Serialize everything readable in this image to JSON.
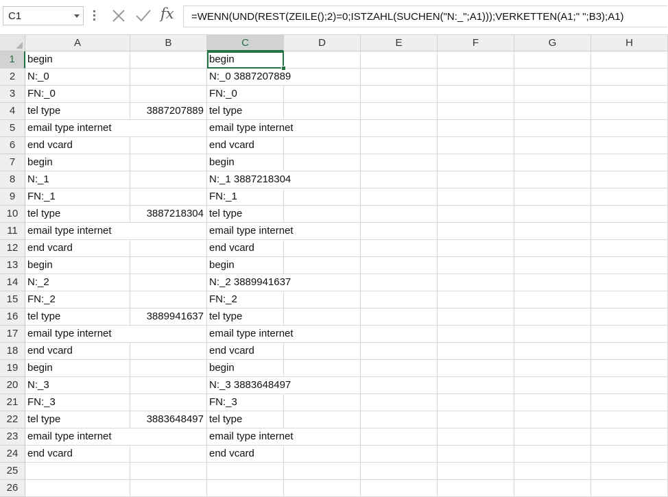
{
  "name_box": {
    "value": "C1"
  },
  "formula_bar": {
    "cancel_icon": "close-x-icon",
    "enter_icon": "checkmark-icon",
    "fx_label": "fx",
    "formula": "=WENN(UND(REST(ZEILE();2)=0;ISTZAHL(SUCHEN(\"N:_\";A1)));VERKETTEN(A1;\" \";B3);A1)"
  },
  "columns": [
    "A",
    "B",
    "C",
    "D",
    "E",
    "F",
    "G",
    "H"
  ],
  "selected_cell": {
    "column": "C",
    "row": 1
  },
  "rows": [
    {
      "n": "1",
      "a": "begin",
      "b": "",
      "c": "begin"
    },
    {
      "n": "2",
      "a": "N:_0",
      "b": "",
      "c": "N:_0 3887207889"
    },
    {
      "n": "3",
      "a": "FN:_0",
      "b": "",
      "c": "FN:_0"
    },
    {
      "n": "4",
      "a": "tel type",
      "b": "3887207889",
      "c": "tel type"
    },
    {
      "n": "5",
      "a": "email type internet",
      "b": "",
      "c": "email type internet"
    },
    {
      "n": "6",
      "a": "end vcard",
      "b": "",
      "c": "end vcard"
    },
    {
      "n": "7",
      "a": "begin",
      "b": "",
      "c": "begin"
    },
    {
      "n": "8",
      "a": "N:_1",
      "b": "",
      "c": "N:_1 3887218304"
    },
    {
      "n": "9",
      "a": "FN:_1",
      "b": "",
      "c": "FN:_1"
    },
    {
      "n": "10",
      "a": "tel type",
      "b": "3887218304",
      "c": "tel type"
    },
    {
      "n": "11",
      "a": "email type internet",
      "b": "",
      "c": "email type internet"
    },
    {
      "n": "12",
      "a": "end vcard",
      "b": "",
      "c": "end vcard"
    },
    {
      "n": "13",
      "a": "begin",
      "b": "",
      "c": "begin"
    },
    {
      "n": "14",
      "a": "N:_2",
      "b": "",
      "c": "N:_2 3889941637"
    },
    {
      "n": "15",
      "a": "FN:_2",
      "b": "",
      "c": "FN:_2"
    },
    {
      "n": "16",
      "a": "tel type",
      "b": "3889941637",
      "c": "tel type"
    },
    {
      "n": "17",
      "a": "email type internet",
      "b": "",
      "c": "email type internet"
    },
    {
      "n": "18",
      "a": "end vcard",
      "b": "",
      "c": "end vcard"
    },
    {
      "n": "19",
      "a": "begin",
      "b": "",
      "c": "begin"
    },
    {
      "n": "20",
      "a": "N:_3",
      "b": "",
      "c": "N:_3 3883648497"
    },
    {
      "n": "21",
      "a": "FN:_3",
      "b": "",
      "c": "FN:_3"
    },
    {
      "n": "22",
      "a": "tel type",
      "b": "3883648497",
      "c": "tel type"
    },
    {
      "n": "23",
      "a": "email type internet",
      "b": "",
      "c": "email type internet"
    },
    {
      "n": "24",
      "a": "end vcard",
      "b": "",
      "c": "end vcard"
    },
    {
      "n": "25",
      "a": "",
      "b": "",
      "c": ""
    },
    {
      "n": "26",
      "a": "",
      "b": "",
      "c": ""
    }
  ],
  "colors": {
    "accent": "#217346"
  }
}
